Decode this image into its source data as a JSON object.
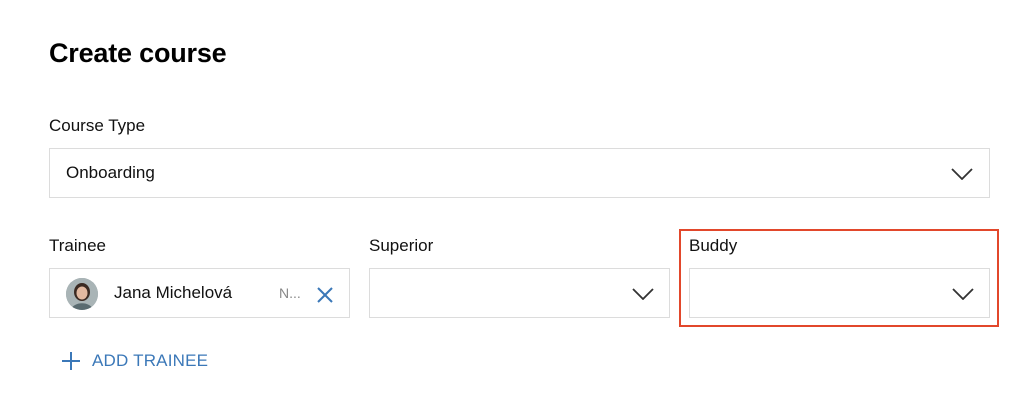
{
  "page": {
    "title": "Create course"
  },
  "course_type": {
    "label": "Course Type",
    "value": "Onboarding",
    "chevron_icon": "chevron-down-icon"
  },
  "trainee": {
    "label": "Trainee",
    "selected_name": "Jana Michelová",
    "truncated_text": "N...",
    "avatar_icon": "avatar",
    "remove_icon": "close-icon"
  },
  "superior": {
    "label": "Superior",
    "value": ""
  },
  "buddy": {
    "label": "Buddy",
    "value": ""
  },
  "add_trainee": {
    "label": "ADD TRAINEE",
    "icon": "plus-icon"
  },
  "colors": {
    "accent": "#3b78b8",
    "highlight": "#e2472b",
    "border": "#dcdcdc"
  }
}
